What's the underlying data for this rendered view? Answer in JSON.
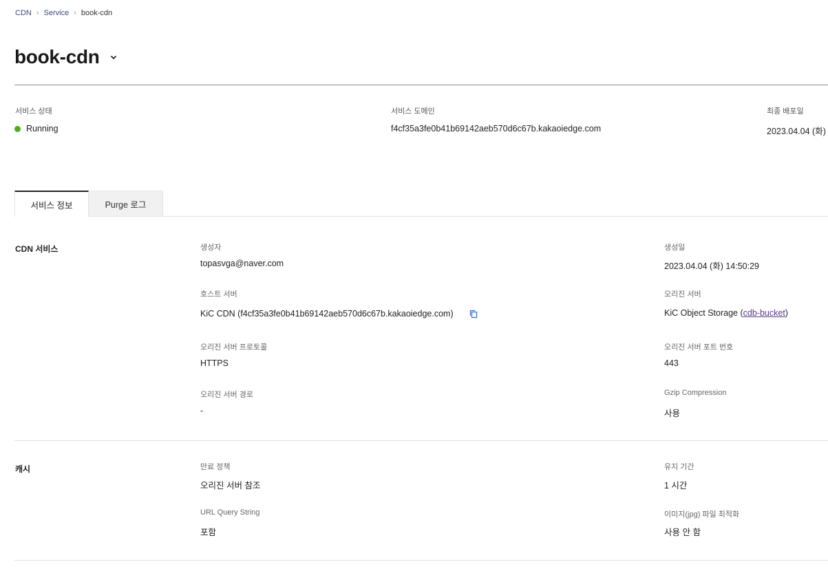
{
  "breadcrumb": {
    "items": [
      "CDN",
      "Service",
      "book-cdn"
    ]
  },
  "header": {
    "title": "book-cdn"
  },
  "summary": {
    "status_label": "서비스 상태",
    "status_value": "Running",
    "status_color": "#4caf1a",
    "domain_label": "서비스 도메인",
    "domain_value": "f4cf35a3fe0b41b69142aeb570d6c67b.kakaoiedge.com",
    "deploy_label": "최종 배포일",
    "deploy_value": "2023.04.04 (화)"
  },
  "tabs": [
    {
      "label": "서비스 정보",
      "active": true
    },
    {
      "label": "Purge 로그",
      "active": false
    }
  ],
  "cdn_section": {
    "title": "CDN 서비스",
    "creator_label": "생성자",
    "creator_value": "topasvga@naver.com",
    "created_label": "생성일",
    "created_value": "2023.04.04 (화) 14:50:29",
    "host_label": "호스트 서버",
    "host_value": "KiC CDN (f4cf35a3fe0b41b69142aeb570d6c67b.kakaoiedge.com)",
    "origin_label": "오리진 서버",
    "origin_prefix": "KiC Object Storage (",
    "origin_link": "cdb-bucket",
    "origin_suffix": ")",
    "protocol_label": "오리진 서버 프로토콜",
    "protocol_value": "HTTPS",
    "port_label": "오리진 서버 포트 번호",
    "port_value": "443",
    "path_label": "오리진 서버 경로",
    "path_value": "-",
    "gzip_label": "Gzip Compression",
    "gzip_value": "사용"
  },
  "cache_section": {
    "title": "캐시",
    "expiry_label": "만료 정책",
    "expiry_value": "오리진 서버 참조",
    "ttl_label": "유지 기간",
    "ttl_value": "1 시간",
    "query_label": "URL Query String",
    "query_value": "포함",
    "image_label": "이미지(jpg) 파일 최적화",
    "image_value": "사용 안 함"
  },
  "icons": {
    "breadcrumb_separator": "chevron-right-icon",
    "title_dropdown": "chevron-down-icon",
    "copy": "copy-icon"
  }
}
